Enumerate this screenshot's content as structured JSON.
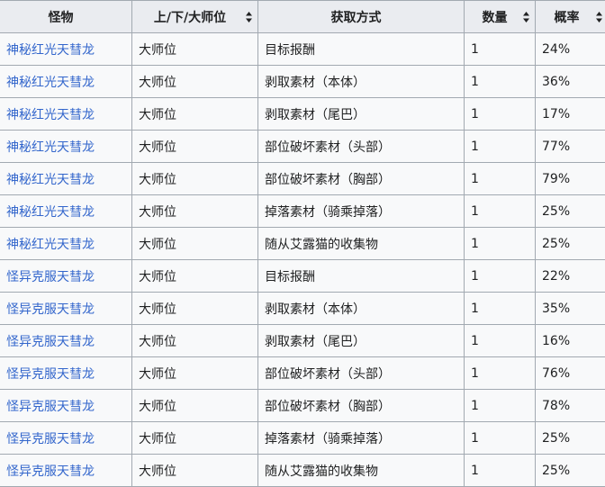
{
  "table": {
    "headers": [
      {
        "label": "怪物",
        "sortable": false
      },
      {
        "label": "上/下/大师位",
        "sortable": true
      },
      {
        "label": "获取方式",
        "sortable": false
      },
      {
        "label": "数量",
        "sortable": true
      },
      {
        "label": "概率",
        "sortable": true
      }
    ],
    "rows": [
      {
        "monster": "神秘红光天彗龙",
        "rank": "大师位",
        "method": "目标报酬",
        "quantity": "1",
        "rate": "24%"
      },
      {
        "monster": "神秘红光天彗龙",
        "rank": "大师位",
        "method": "剥取素材（本体）",
        "quantity": "1",
        "rate": "36%"
      },
      {
        "monster": "神秘红光天彗龙",
        "rank": "大师位",
        "method": "剥取素材（尾巴）",
        "quantity": "1",
        "rate": "17%"
      },
      {
        "monster": "神秘红光天彗龙",
        "rank": "大师位",
        "method": "部位破坏素材（头部）",
        "quantity": "1",
        "rate": "77%"
      },
      {
        "monster": "神秘红光天彗龙",
        "rank": "大师位",
        "method": "部位破坏素材（胸部）",
        "quantity": "1",
        "rate": "79%"
      },
      {
        "monster": "神秘红光天彗龙",
        "rank": "大师位",
        "method": "掉落素材（骑乘掉落）",
        "quantity": "1",
        "rate": "25%"
      },
      {
        "monster": "神秘红光天彗龙",
        "rank": "大师位",
        "method": "随从艾露猫的收集物",
        "quantity": "1",
        "rate": "25%"
      },
      {
        "monster": "怪异克服天彗龙",
        "rank": "大师位",
        "method": "目标报酬",
        "quantity": "1",
        "rate": "22%"
      },
      {
        "monster": "怪异克服天彗龙",
        "rank": "大师位",
        "method": "剥取素材（本体）",
        "quantity": "1",
        "rate": "35%"
      },
      {
        "monster": "怪异克服天彗龙",
        "rank": "大师位",
        "method": "剥取素材（尾巴）",
        "quantity": "1",
        "rate": "16%"
      },
      {
        "monster": "怪异克服天彗龙",
        "rank": "大师位",
        "method": "部位破坏素材（头部）",
        "quantity": "1",
        "rate": "76%"
      },
      {
        "monster": "怪异克服天彗龙",
        "rank": "大师位",
        "method": "部位破坏素材（胸部）",
        "quantity": "1",
        "rate": "78%"
      },
      {
        "monster": "怪异克服天彗龙",
        "rank": "大师位",
        "method": "掉落素材（骑乘掉落）",
        "quantity": "1",
        "rate": "25%"
      },
      {
        "monster": "怪异克服天彗龙",
        "rank": "大师位",
        "method": "随从艾露猫的收集物",
        "quantity": "1",
        "rate": "25%"
      }
    ]
  },
  "colors": {
    "link": "#3366cc",
    "header_bg": "#eaecf0",
    "cell_bg": "#f8f9fa",
    "border": "#a2a9b1"
  }
}
